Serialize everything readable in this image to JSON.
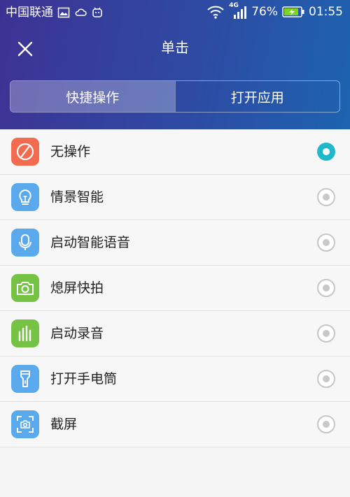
{
  "status_bar": {
    "carrier": "中国联通",
    "network": "4G",
    "battery": "76%",
    "time": "01:55",
    "icons": [
      "image-icon",
      "cloud-icon",
      "android-icon",
      "wifi-icon",
      "signal-icon",
      "battery-charging-icon"
    ]
  },
  "header": {
    "title": "单击",
    "close_icon": "close-icon"
  },
  "tabs": [
    {
      "label": "快捷操作",
      "selected": true
    },
    {
      "label": "打开应用",
      "selected": false
    }
  ],
  "options": [
    {
      "label": "无操作",
      "icon": "no-action-icon",
      "icon_color": "#f26b4f",
      "selected": true
    },
    {
      "label": "情景智能",
      "icon": "lightbulb-icon",
      "icon_color": "#5aa9ec",
      "selected": false
    },
    {
      "label": "启动智能语音",
      "icon": "microphone-icon",
      "icon_color": "#5aa9ec",
      "selected": false
    },
    {
      "label": "熄屏快拍",
      "icon": "camera-icon",
      "icon_color": "#76c244",
      "selected": false
    },
    {
      "label": "启动录音",
      "icon": "audio-bars-icon",
      "icon_color": "#76c244",
      "selected": false
    },
    {
      "label": "打开手电筒",
      "icon": "flashlight-icon",
      "icon_color": "#5aa9ec",
      "selected": false
    },
    {
      "label": "截屏",
      "icon": "screenshot-icon",
      "icon_color": "#5aa9ec",
      "selected": false
    }
  ],
  "colors": {
    "header_gradient_start": "#3d3294",
    "header_gradient_end": "#1d63b0",
    "radio_selected": "#21b8c9"
  }
}
